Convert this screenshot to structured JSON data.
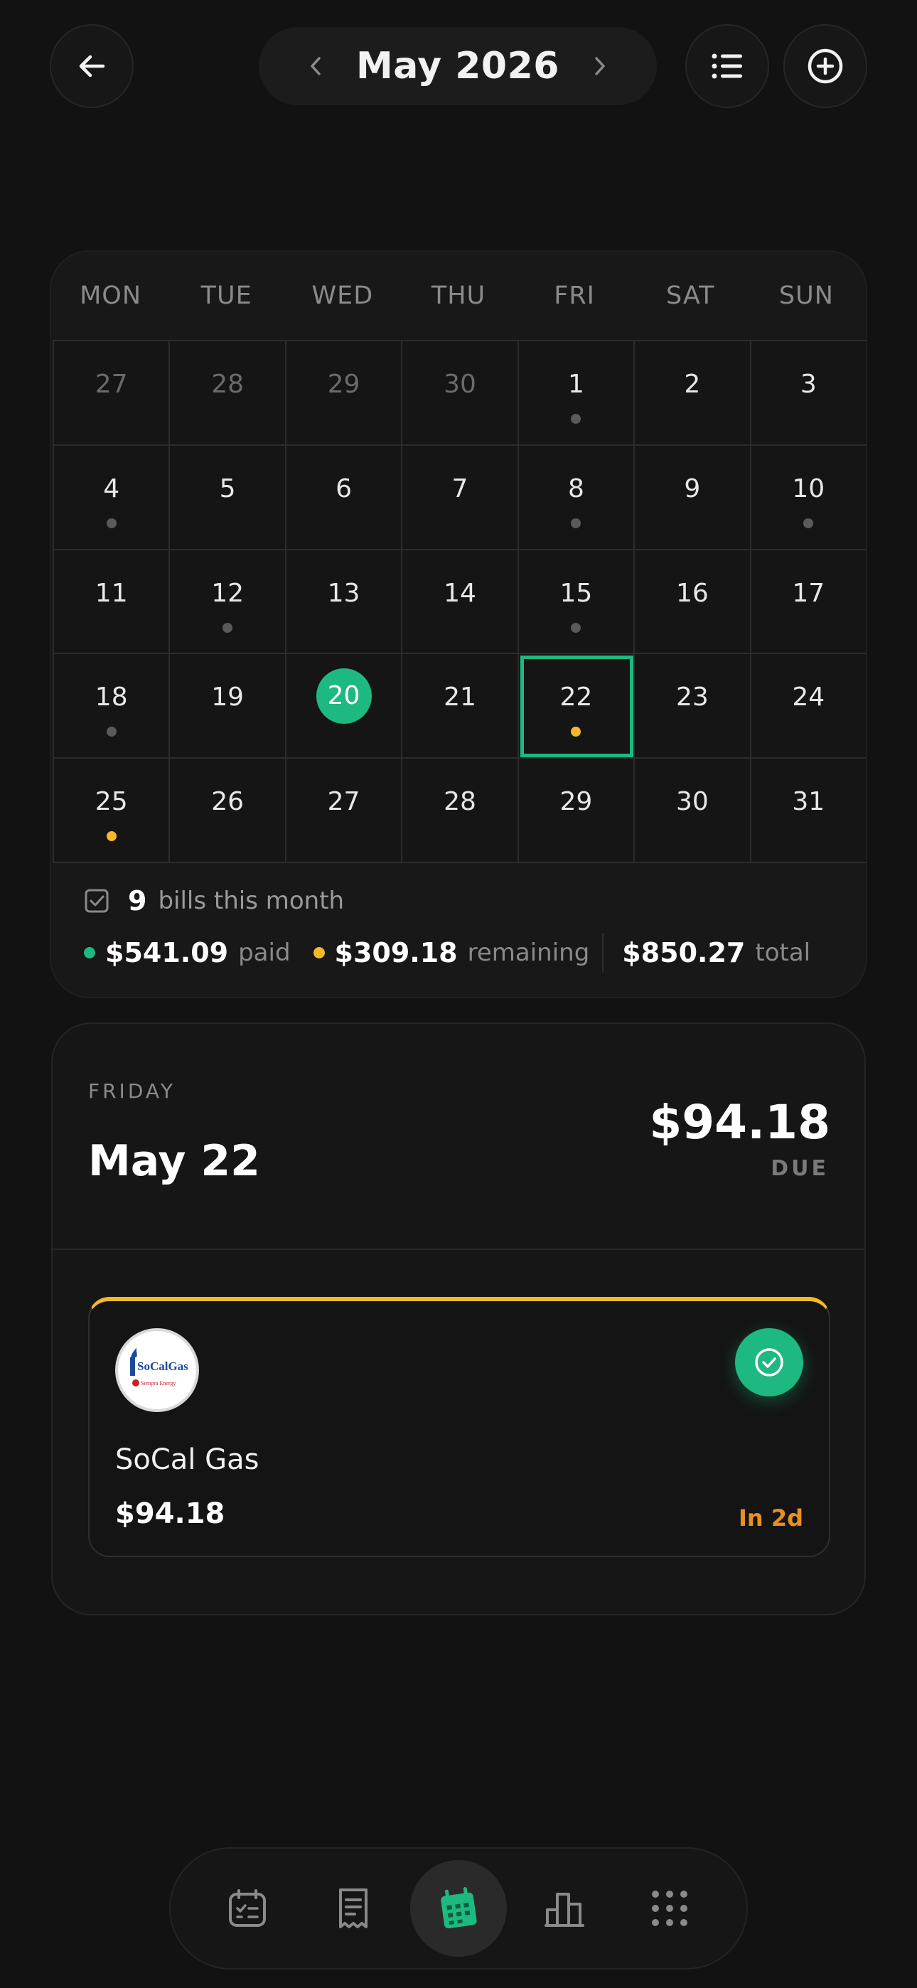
{
  "header": {
    "month_label": "May 2026"
  },
  "calendar": {
    "weekdays": [
      "MON",
      "TUE",
      "WED",
      "THU",
      "FRI",
      "SAT",
      "SUN"
    ],
    "days": [
      {
        "label": "27",
        "muted": true,
        "dot": null
      },
      {
        "label": "28",
        "muted": true,
        "dot": null
      },
      {
        "label": "29",
        "muted": true,
        "dot": null
      },
      {
        "label": "30",
        "muted": true,
        "dot": null
      },
      {
        "label": "1",
        "muted": false,
        "dot": "gray"
      },
      {
        "label": "2",
        "muted": false,
        "dot": null
      },
      {
        "label": "3",
        "muted": false,
        "dot": null
      },
      {
        "label": "4",
        "muted": false,
        "dot": "gray"
      },
      {
        "label": "5",
        "muted": false,
        "dot": null
      },
      {
        "label": "6",
        "muted": false,
        "dot": null
      },
      {
        "label": "7",
        "muted": false,
        "dot": null
      },
      {
        "label": "8",
        "muted": false,
        "dot": "gray"
      },
      {
        "label": "9",
        "muted": false,
        "dot": null
      },
      {
        "label": "10",
        "muted": false,
        "dot": "gray"
      },
      {
        "label": "11",
        "muted": false,
        "dot": null
      },
      {
        "label": "12",
        "muted": false,
        "dot": "gray"
      },
      {
        "label": "13",
        "muted": false,
        "dot": null
      },
      {
        "label": "14",
        "muted": false,
        "dot": null
      },
      {
        "label": "15",
        "muted": false,
        "dot": "gray"
      },
      {
        "label": "16",
        "muted": false,
        "dot": null
      },
      {
        "label": "17",
        "muted": false,
        "dot": null
      },
      {
        "label": "18",
        "muted": false,
        "dot": "gray"
      },
      {
        "label": "19",
        "muted": false,
        "dot": null
      },
      {
        "label": "20",
        "muted": false,
        "dot": null,
        "today": true
      },
      {
        "label": "21",
        "muted": false,
        "dot": null
      },
      {
        "label": "22",
        "muted": false,
        "dot": "yellow",
        "selected": true
      },
      {
        "label": "23",
        "muted": false,
        "dot": null
      },
      {
        "label": "24",
        "muted": false,
        "dot": null
      },
      {
        "label": "25",
        "muted": false,
        "dot": "yellow"
      },
      {
        "label": "26",
        "muted": false,
        "dot": null
      },
      {
        "label": "27",
        "muted": false,
        "dot": null
      },
      {
        "label": "28",
        "muted": false,
        "dot": null
      },
      {
        "label": "29",
        "muted": false,
        "dot": null
      },
      {
        "label": "30",
        "muted": false,
        "dot": null
      },
      {
        "label": "31",
        "muted": false,
        "dot": null
      }
    ]
  },
  "summary": {
    "bill_count": "9",
    "bill_count_label": "bills this month",
    "paid_amount": "$541.09",
    "paid_label": "paid",
    "remaining_amount": "$309.18",
    "remaining_label": "remaining",
    "total_amount": "$850.27",
    "total_label": "total"
  },
  "selected_day": {
    "weekday": "FRIDAY",
    "date": "May 22",
    "amount": "$94.18",
    "amount_label": "DUE"
  },
  "bill": {
    "logo_text": "SoCalGas",
    "logo_subtext": "Sempra Energy",
    "name": "SoCal Gas",
    "amount": "$94.18",
    "due_in": "In 2d"
  },
  "nav": {
    "items": [
      "calendar-check-icon",
      "receipt-icon",
      "calendar-icon",
      "bar-chart-icon",
      "grid-icon"
    ],
    "active": "calendar-icon"
  },
  "colors": {
    "accent_green": "#1db980",
    "accent_yellow": "#f4b82a",
    "due_orange": "#e8901f",
    "background": "#121212"
  }
}
